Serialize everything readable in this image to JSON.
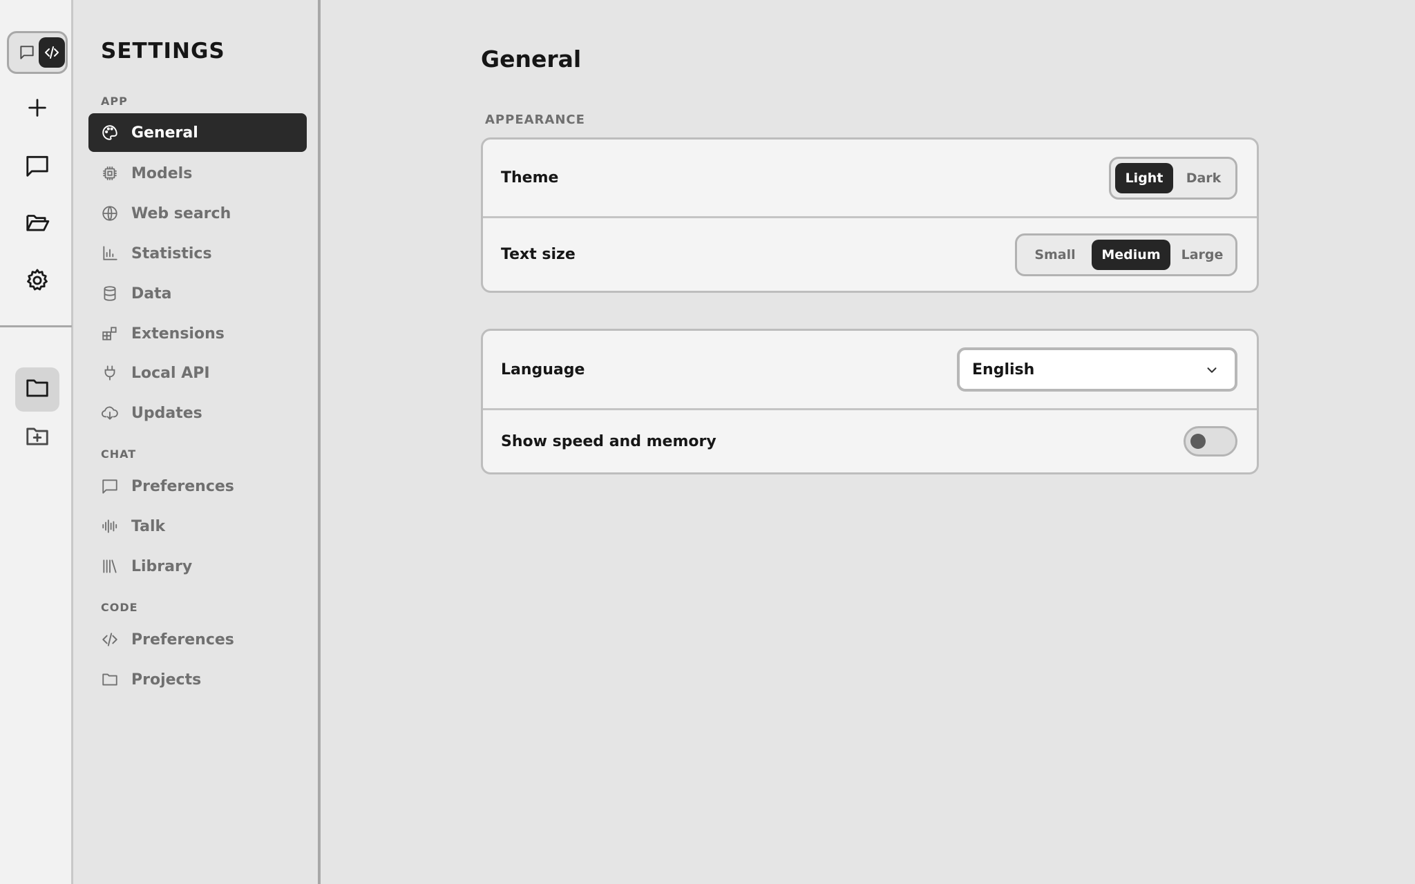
{
  "rail": {
    "mode_chat_icon": "chat-bubble-icon",
    "mode_code_icon": "code-icon",
    "items": [
      {
        "name": "new-chat-button",
        "icon": "plus-icon"
      },
      {
        "name": "chats-button",
        "icon": "chat-bubble-icon"
      },
      {
        "name": "open-folder-button",
        "icon": "folder-open-icon"
      },
      {
        "name": "settings-button",
        "icon": "gear-icon"
      }
    ],
    "bottom": [
      {
        "name": "projects-button",
        "icon": "folder-icon",
        "active": true
      },
      {
        "name": "new-project-button",
        "icon": "folder-plus-icon"
      }
    ]
  },
  "nav": {
    "title": "SETTINGS",
    "sections": {
      "app": "APP",
      "chat": "CHAT",
      "code": "CODE"
    },
    "items": {
      "general": "General",
      "models": "Models",
      "web_search": "Web search",
      "statistics": "Statistics",
      "data": "Data",
      "extensions": "Extensions",
      "local_api": "Local API",
      "updates": "Updates",
      "chat_preferences": "Preferences",
      "talk": "Talk",
      "library": "Library",
      "code_preferences": "Preferences",
      "projects": "Projects"
    },
    "active": "general"
  },
  "main": {
    "title": "General",
    "appearance_label": "APPEARANCE",
    "theme": {
      "label": "Theme",
      "options": [
        "Light",
        "Dark"
      ],
      "selected": "Light"
    },
    "text_size": {
      "label": "Text size",
      "options": [
        "Small",
        "Medium",
        "Large"
      ],
      "selected": "Medium"
    },
    "language": {
      "label": "Language",
      "value": "English"
    },
    "speed_memory": {
      "label": "Show speed and memory",
      "enabled": false
    }
  },
  "colors": {
    "accent_dark": "#262626",
    "background": "#e5e5e5",
    "card": "#f4f4f4",
    "muted_text": "#707070"
  }
}
